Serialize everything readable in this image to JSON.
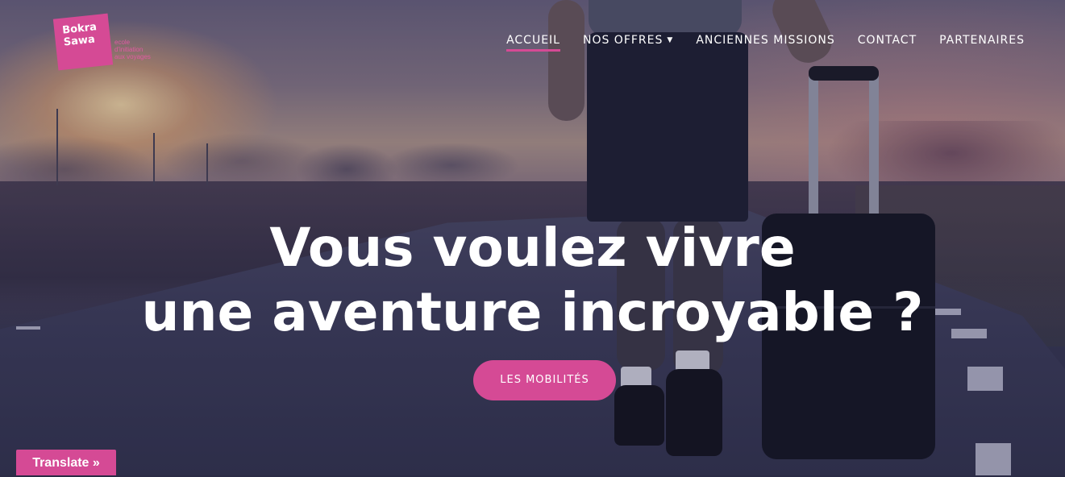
{
  "brand": {
    "logo_text": "Bokra Sawa",
    "tagline_lines": [
      "ecole",
      "d'initiation",
      "aux voyages"
    ]
  },
  "nav": {
    "items": [
      {
        "label": "ACCUEIL",
        "active": true
      },
      {
        "label": "NOS OFFRES",
        "has_dropdown": true
      },
      {
        "label": "ANCIENNES MISSIONS"
      },
      {
        "label": "CONTACT"
      },
      {
        "label": "PARTENAIRES"
      }
    ]
  },
  "hero": {
    "headline_line1": "Vous voulez vivre",
    "headline_line2": "une aventure incroyable ?",
    "cta_label": "LES MOBILITÉS"
  },
  "translate": {
    "label": "Translate »"
  },
  "colors": {
    "accent": "#d54a95",
    "text": "#ffffff"
  },
  "icons": {
    "dropdown": "caret-down-icon"
  }
}
